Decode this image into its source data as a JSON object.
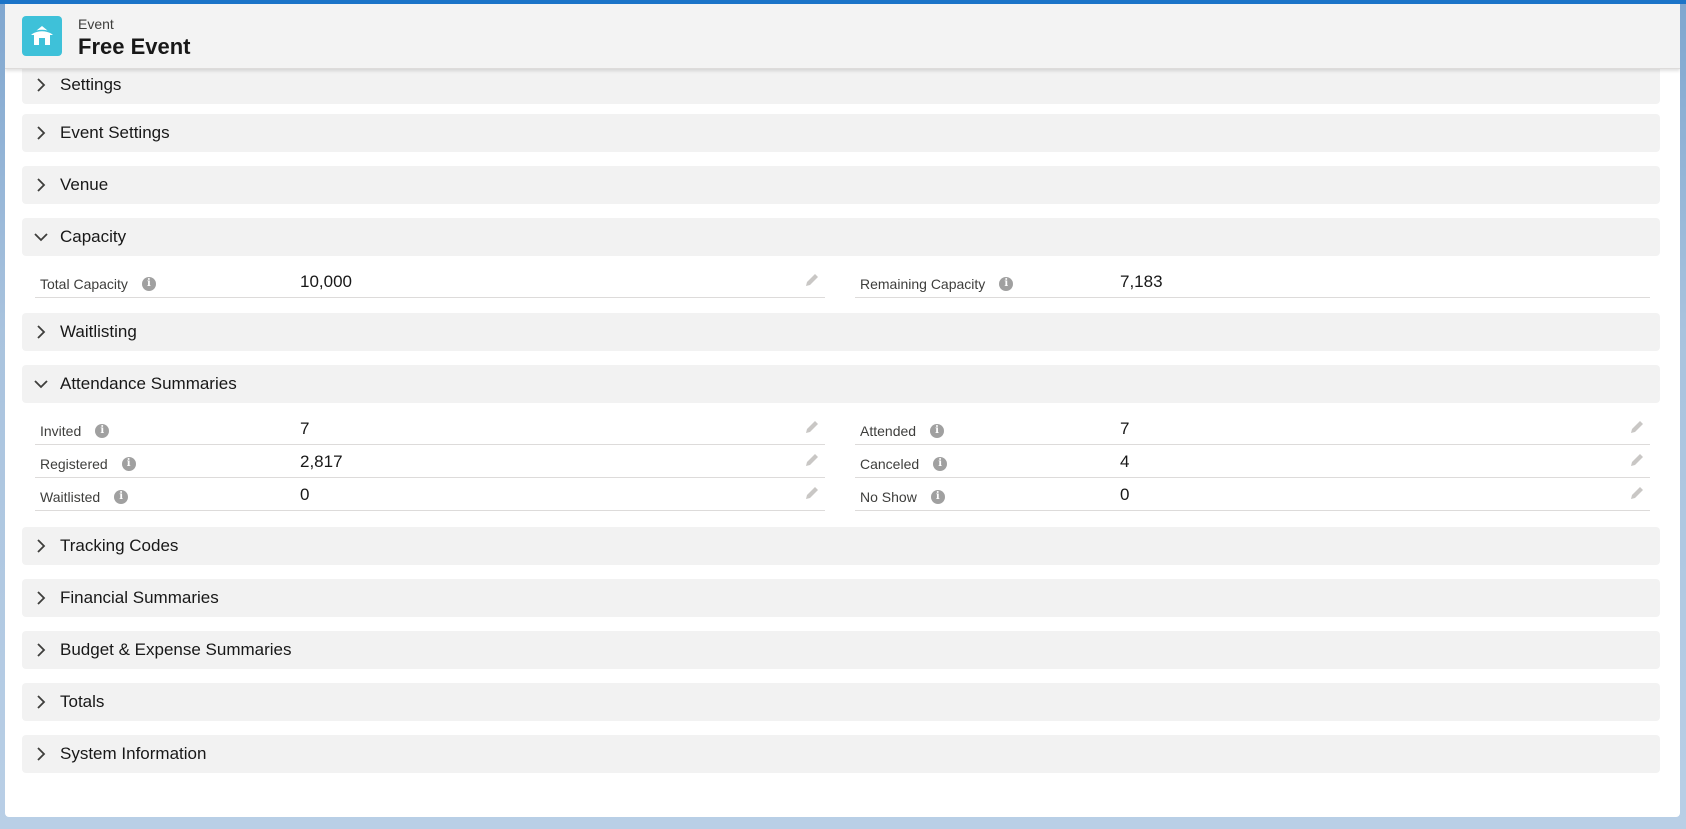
{
  "header": {
    "object_type": "Event",
    "title": "Free Event"
  },
  "sections": [
    {
      "label": "Settings",
      "expanded": false
    },
    {
      "label": "Event Settings",
      "expanded": false
    },
    {
      "label": "Venue",
      "expanded": false
    },
    {
      "label": "Capacity",
      "expanded": true
    },
    {
      "label": "Waitlisting",
      "expanded": false
    },
    {
      "label": "Attendance Summaries",
      "expanded": true
    },
    {
      "label": "Tracking Codes",
      "expanded": false
    },
    {
      "label": "Financial Summaries",
      "expanded": false
    },
    {
      "label": "Budget & Expense Summaries",
      "expanded": false
    },
    {
      "label": "Totals",
      "expanded": false
    },
    {
      "label": "System Information",
      "expanded": false
    }
  ],
  "capacity": {
    "total_label": "Total Capacity",
    "total_value": "10,000",
    "remaining_label": "Remaining Capacity",
    "remaining_value": "7,183"
  },
  "attendance": {
    "invited_label": "Invited",
    "invited_value": "7",
    "registered_label": "Registered",
    "registered_value": "2,817",
    "waitlisted_label": "Waitlisted",
    "waitlisted_value": "0",
    "attended_label": "Attended",
    "attended_value": "7",
    "canceled_label": "Canceled",
    "canceled_value": "4",
    "noshow_label": "No Show",
    "noshow_value": "0"
  },
  "icons": {
    "object_icon": "event-house-icon",
    "info_icon": "info-icon",
    "edit_icon": "pencil-icon",
    "collapsed_icon": "chevron-right-icon",
    "expanded_icon": "chevron-down-icon"
  },
  "colors": {
    "accent_bar": "#1b74c8",
    "object_icon_bg": "#3ec1d9",
    "section_bg": "#f2f2f2"
  }
}
